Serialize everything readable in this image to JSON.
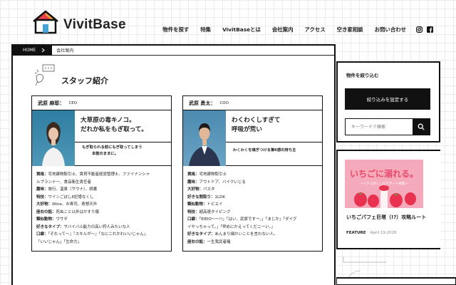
{
  "brand": {
    "name": "VivitBase"
  },
  "nav": [
    "物件を探す",
    "特集",
    "VivitBaseとは",
    "会社案内",
    "アクセス",
    "空き家相談",
    "お問い合わせ"
  ],
  "breadcrumb": {
    "home": "HOME",
    "current": "会社案内"
  },
  "page_title": "スタッフ紹介",
  "staff": [
    {
      "name": "武原 麻耶：",
      "role": "CEO",
      "catch": [
        "大草原の毒キノコ。",
        "だれか私をもぎ取って。"
      ],
      "sub": [
        "もぎ取られる前にもぎ取ってしまう",
        "本能のままに。"
      ],
      "profile": [
        {
          "k": "資格：",
          "v": "宅地建物取引士、賃貸不動産経営管理士、ファイナンシャ"
        },
        {
          "k": "",
          "v": "ルプランナー、食品衛生責任者"
        },
        {
          "k": "趣味：",
          "v": "旅行、温泉（サウナ）、読書"
        },
        {
          "k": "特技：",
          "v": "ワインごぼし6記憶なくし"
        },
        {
          "k": "大好物：",
          "v": "Wine、お寿司、奇想天外"
        },
        {
          "k": "座右の銘：",
          "v": "死ぬこと以外はかすり傷"
        },
        {
          "k": "類似動物：",
          "v": "ウサギ"
        },
        {
          "k": "好きなタイプ：",
          "v": "サバイバル能力の高い狩人みたいな人"
        },
        {
          "k": "口癖：",
          "v": "「それって〜」「スキルが〜」「なにこれかわいいじゃん」"
        },
        {
          "k": "",
          "v": "「いいじゃん」「生命力」"
        }
      ]
    },
    {
      "name": "武原 勇太：",
      "role": "COO",
      "catch": [
        "わくわくしすぎて",
        "呼吸が荒い"
      ],
      "sub": [
        "わくわくを嗅ぎつける第6感の持ち主"
      ],
      "profile": [
        {
          "k": "資格：",
          "v": "宅地建物取引士"
        },
        {
          "k": "趣味：",
          "v": "アウトドア、バイクいじる"
        },
        {
          "k": "大好物：",
          "v": "パスタ"
        },
        {
          "k": "好きな間取り：",
          "v": "1LDK"
        },
        {
          "k": "類似動物：",
          "v": "トビエイ"
        },
        {
          "k": "特技：",
          "v": "超高速タイピング"
        },
        {
          "k": "口癖：",
          "v": "「EIEIO〜〜!!」「はい、武原ですー。」「まじか」「ダイグ"
        },
        {
          "k": "",
          "v": "イやっちゃって。」「早めにかえってくだニーい。」"
        },
        {
          "k": "好きなタイプ：",
          "v": "あんまり細かいことを言わない人。"
        },
        {
          "k": "座右の銘：",
          "v": "一生我武者羅"
        }
      ]
    }
  ],
  "sidebar": {
    "title": "物件を絞り込む",
    "filter_button": "絞り込みを設定する",
    "search_placeholder": "キーワードで検索"
  },
  "article": {
    "image_text": "いちごに溺れる。",
    "image_sub": "〜イチゴ尽くしなデザート特集〜",
    "title": "いちごパフェ巨塔（!?）攻略ルート",
    "category": "FEATURE",
    "date": "April.19.2026"
  },
  "colors": {
    "ink": "#111111",
    "photo1": "#3f88a8",
    "photo2": "#5a8fb0",
    "strawberry": "#e8486a"
  },
  "icons": [
    "house-logo-icon",
    "instagram-icon",
    "facebook-icon",
    "chevron-right-icon",
    "search-icon",
    "speech-bubble-icon"
  ]
}
